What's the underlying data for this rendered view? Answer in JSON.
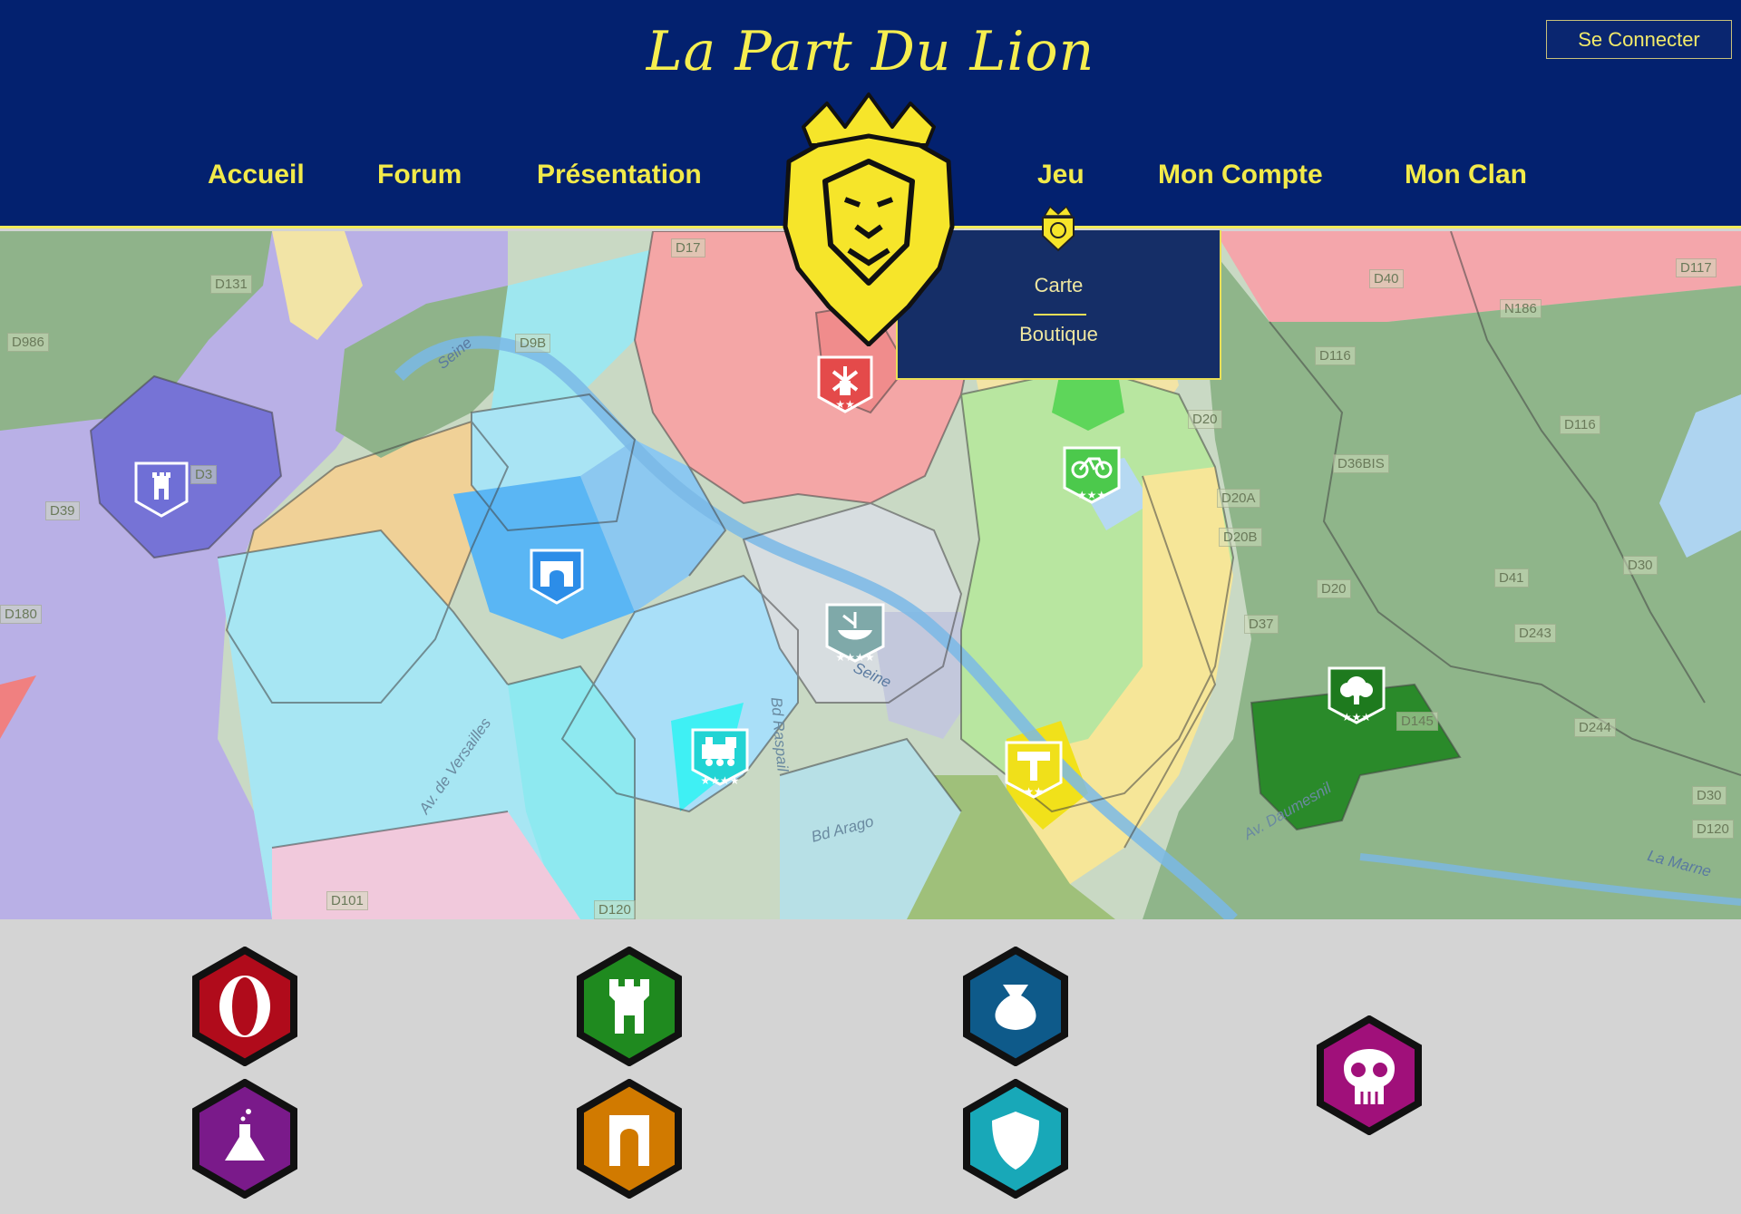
{
  "header": {
    "site_title": "La Part Du Lion",
    "login_label": "Se Connecter",
    "background_color": "#03216f",
    "accent_color": "#f4ec5a"
  },
  "nav": {
    "items": [
      {
        "label": "Accueil"
      },
      {
        "label": "Forum"
      },
      {
        "label": "Présentation"
      },
      {
        "label": "Jeu"
      },
      {
        "label": "Mon Compte"
      },
      {
        "label": "Mon Clan"
      }
    ]
  },
  "jeu_dropdown": {
    "items": [
      {
        "label": "Carte"
      },
      {
        "label": "Boutique"
      }
    ]
  },
  "map": {
    "road_labels": [
      "D17",
      "D131",
      "D986",
      "D9B",
      "D3",
      "D39",
      "D180",
      "D101",
      "D120",
      "D40",
      "D117",
      "N186",
      "D116",
      "D20",
      "D116",
      "D36BIS",
      "D20A",
      "D20B",
      "D41",
      "D30",
      "D20",
      "D37",
      "D243",
      "D145",
      "D244",
      "D30",
      "D120"
    ],
    "river_labels": [
      "Seine",
      "Seine",
      "La Marne"
    ],
    "street_labels": [
      "Av. de Versailles",
      "Bd Raspail",
      "Bd Arago",
      "Av. Daumesnil"
    ],
    "markers": [
      {
        "icon": "castle-icon",
        "stars": 0,
        "color": "#6f6fd6"
      },
      {
        "icon": "windmill-icon",
        "stars": 2,
        "color": "#e44a4a"
      },
      {
        "icon": "bicycle-icon",
        "stars": 3,
        "color": "#4cc94c"
      },
      {
        "icon": "arch-icon",
        "stars": 0,
        "color": "#2c8de8"
      },
      {
        "icon": "boat-icon",
        "stars": 4,
        "color": "#7fa9a9"
      },
      {
        "icon": "tree-icon",
        "stars": 3,
        "color": "#1e7a1e"
      },
      {
        "icon": "train-icon",
        "stars": 4,
        "color": "#22d4d4"
      },
      {
        "icon": "hammer-icon",
        "stars": 2,
        "color": "#f0e01a"
      }
    ]
  },
  "clan_icons": [
    {
      "name": "opera-icon",
      "color": "#b00b1b"
    },
    {
      "name": "tower-icon",
      "color": "#1f8a1f"
    },
    {
      "name": "money-bag-icon",
      "color": "#0e5a8a"
    },
    {
      "name": "skull-icon",
      "color": "#a0107a"
    },
    {
      "name": "flask-icon",
      "color": "#7a1a8a"
    },
    {
      "name": "archway-icon",
      "color": "#d17a00"
    },
    {
      "name": "shield-icon",
      "color": "#18a8b8"
    }
  ]
}
